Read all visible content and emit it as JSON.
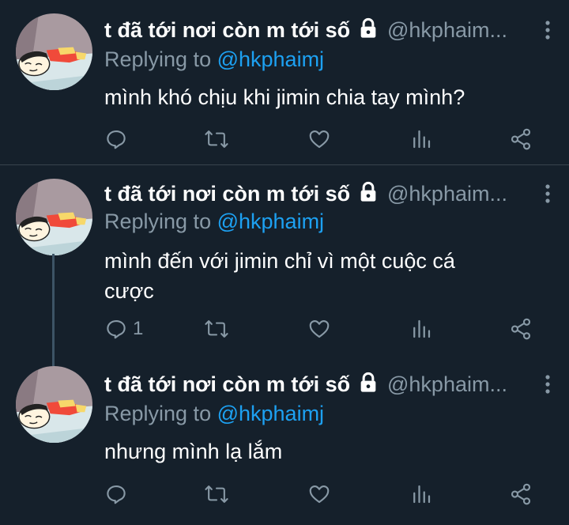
{
  "colors": {
    "background": "#15202b",
    "accent": "#1da1f2",
    "secondary_text": "#8899a6",
    "divider": "#38444d"
  },
  "tweets": [
    {
      "name": "t đã tới nơi còn m tới số",
      "handle": "@hkphaim...",
      "replying_prefix": "Replying to ",
      "replying_to": "@hkphaimj",
      "text": "mình khó chịu khi jimin chia tay mình?",
      "reply_count": ""
    },
    {
      "name": "t đã tới nơi còn m tới số",
      "handle": "@hkphaim...",
      "replying_prefix": "Replying to ",
      "replying_to": "@hkphaimj",
      "text": "mình đến với jimin chỉ vì một cuộc cá cược",
      "reply_count": "1"
    },
    {
      "name": "t đã tới nơi còn m tới số",
      "handle": "@hkphaim...",
      "replying_prefix": "Replying to ",
      "replying_to": "@hkphaimj",
      "text": "nhưng mình lạ lắm",
      "reply_count": ""
    }
  ],
  "icons": {
    "lock": "lock-icon",
    "more": "more-vertical-icon",
    "reply": "reply-icon",
    "retweet": "retweet-icon",
    "like": "heart-icon",
    "stats": "analytics-icon",
    "share": "share-icon"
  }
}
